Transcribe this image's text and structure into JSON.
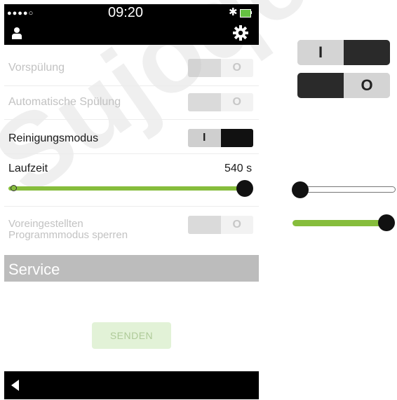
{
  "status_bar": {
    "signal": "●●●●○",
    "time": "09:20",
    "bluetooth": "✱",
    "battery_level": 1.0
  },
  "header": {
    "left_icon": "user-icon",
    "right_icon": "gear-icon"
  },
  "settings": {
    "vorspuelung": {
      "label": "Vorspülung",
      "toggle_on_label": "I",
      "toggle_off_label": "O",
      "state": "off",
      "enabled": false
    },
    "automatische_spuelung": {
      "label": "Automatische Spülung",
      "toggle_on_label": "I",
      "toggle_off_label": "O",
      "state": "off",
      "enabled": false
    },
    "reinigungsmodus": {
      "label": "Reinigungsmodus",
      "toggle_on_label": "I",
      "toggle_off_label": "O",
      "state": "on",
      "enabled": true
    },
    "laufzeit": {
      "label": "Laufzeit",
      "value": "540 s",
      "slider_fraction": 1.0
    },
    "programmmodus": {
      "label_line1": "Voreingestellten",
      "label_line2": "Programmmodus sperren",
      "toggle_off_label": "O",
      "state": "off",
      "enabled": false
    }
  },
  "service": {
    "title": "Service"
  },
  "send_button": {
    "label": "SENDEN",
    "enabled": false
  },
  "bottom_bar": {
    "back_icon": "back-arrow-icon"
  },
  "legend": {
    "toggle_on": {
      "on_label": "I"
    },
    "toggle_off": {
      "off_label": "O"
    },
    "slider_min": {
      "fraction": 0.0
    },
    "slider_max": {
      "fraction": 1.0
    }
  },
  "colors": {
    "accent_green": "#86bd3c",
    "bar_black": "#000000",
    "service_gray": "#bcbcbc"
  }
}
